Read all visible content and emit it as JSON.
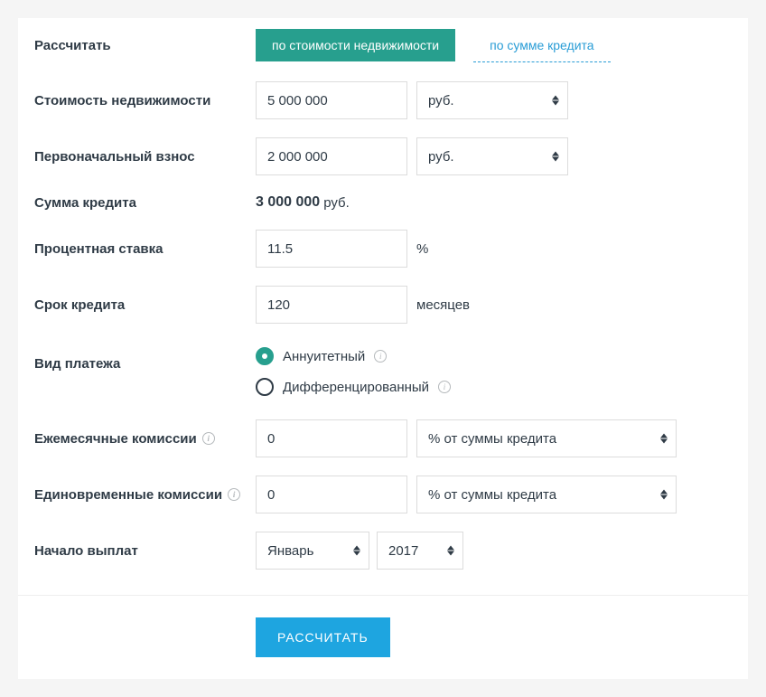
{
  "labels": {
    "calculate_by": "Рассчитать",
    "property_cost": "Стоимость недвижимости",
    "down_payment": "Первоначальный взнос",
    "loan_sum": "Сумма кредита",
    "interest_rate": "Процентная ставка",
    "loan_term": "Срок кредита",
    "payment_type": "Вид платежа",
    "monthly_fees": "Ежемесячные комиссии",
    "onetime_fees": "Единовременные комиссии",
    "start_payments": "Начало выплат"
  },
  "tabs": {
    "by_property": "по стоимости недвижимости",
    "by_loan": "по сумме кредита"
  },
  "values": {
    "property_cost": "5 000 000",
    "down_payment": "2 000 000",
    "loan_sum": "3 000 000",
    "interest_rate": "11.5",
    "loan_term": "120",
    "monthly_fee": "0",
    "onetime_fee": "0",
    "start_month": "Январь",
    "start_year": "2017"
  },
  "units": {
    "currency": "руб.",
    "percent": "%",
    "months": "месяцев",
    "pct_of_loan": "% от суммы кредита"
  },
  "radios": {
    "annuity": "Аннуитетный",
    "differentiated": "Дифференцированный"
  },
  "submit": "РАССЧИТАТЬ"
}
